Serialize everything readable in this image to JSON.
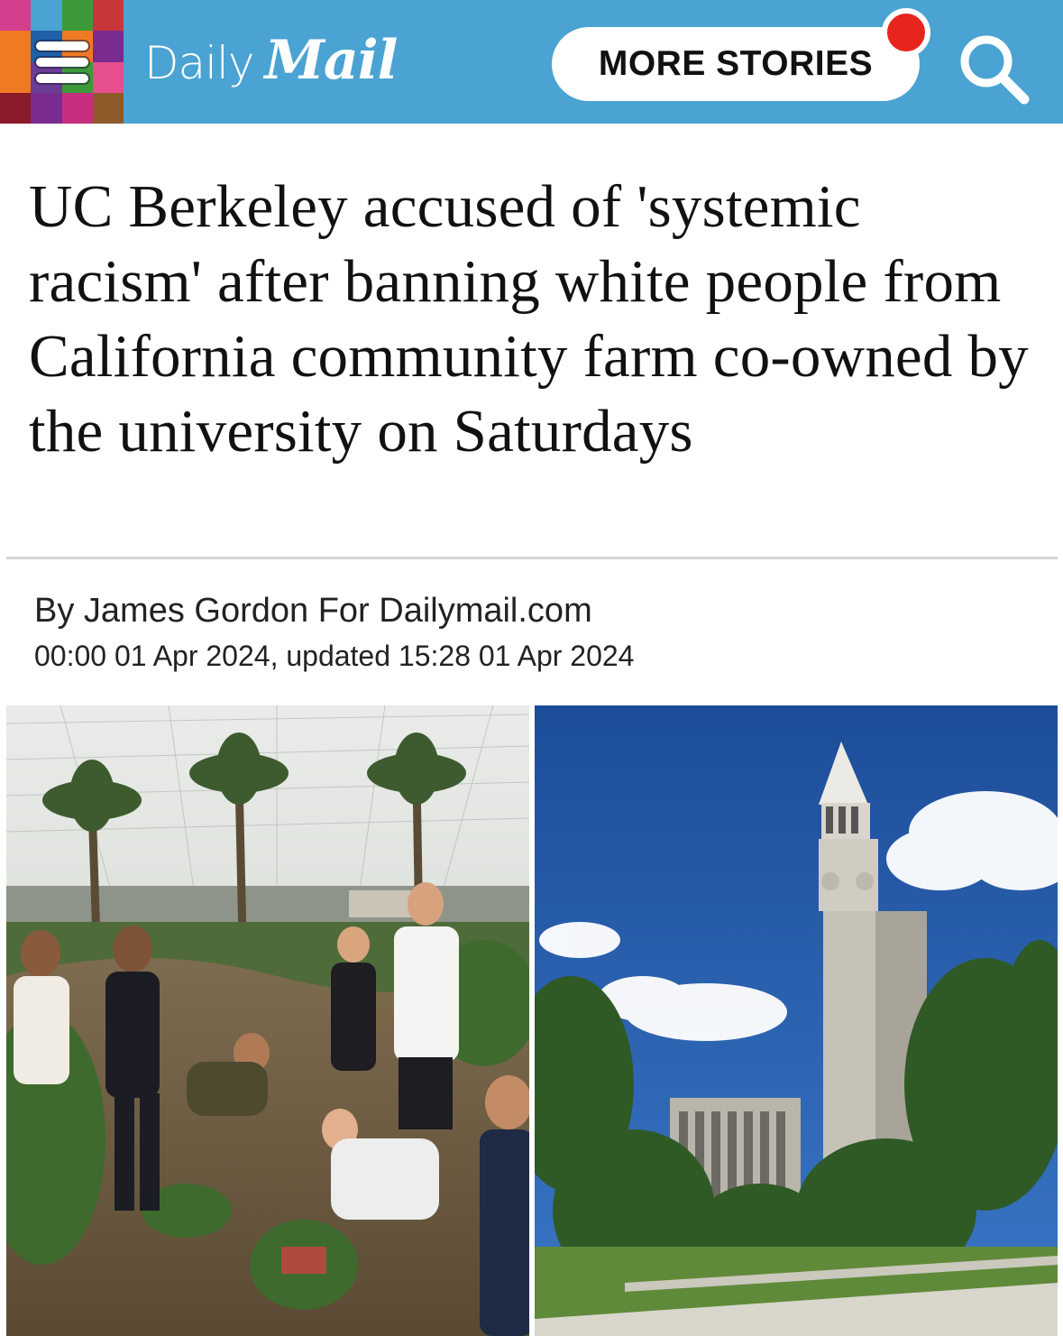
{
  "header": {
    "menu_icon": "hamburger-menu-icon",
    "logo": {
      "daily": "Daily",
      "mail": "Mail"
    },
    "more_stories_label": "MORE STORIES",
    "search_icon": "search-icon",
    "colors": {
      "bar": "#4aa3d2",
      "notification": "#e8251c",
      "mosaic": [
        "#d53e8c",
        "#4aa3d2",
        "#3d9a3a",
        "#c8363a",
        "#ef7a24",
        "#1f5fa8",
        "#ef7a24",
        "#7a2b8f",
        "#ef7a24",
        "#6a3d96",
        "#3d9a3a",
        "#e74e8e",
        "#8b1a2a",
        "#7a2b8f",
        "#c72f7e",
        "#8e5a2a"
      ]
    }
  },
  "article": {
    "headline": "UC Berkeley accused of 'systemic racism' after banning white people from California community farm co-owned by the university on Saturdays",
    "byline": "By James Gordon For Dailymail.com",
    "timestamp": "00:00 01 Apr 2024, updated 15:28 01 Apr 2024"
  },
  "images": [
    {
      "name": "community-farm-volunteers-photo"
    },
    {
      "name": "sather-tower-campus-photo"
    }
  ]
}
